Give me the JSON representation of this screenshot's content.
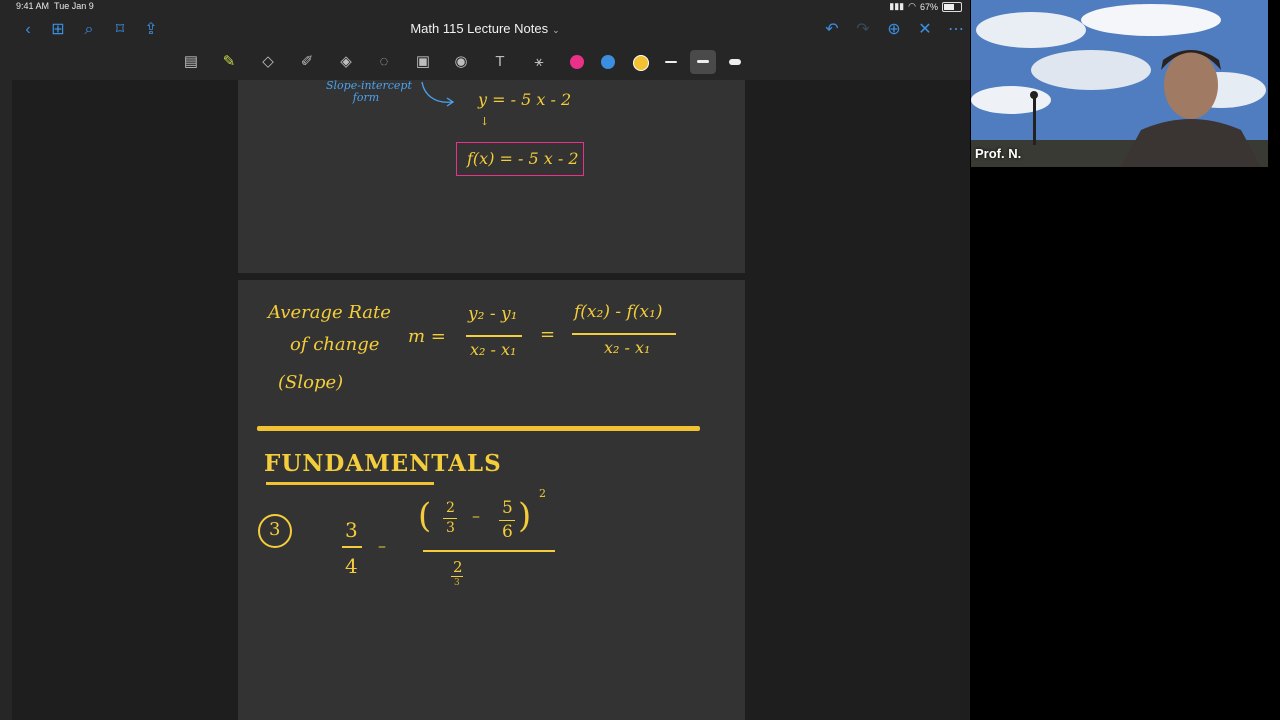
{
  "status_bar": {
    "time": "9:41 AM",
    "date": "Tue Jan 9",
    "battery": "67%"
  },
  "nav": {
    "title": "Math 115 Lecture Notes"
  },
  "toolbar": {
    "colors": [
      "#e9318a",
      "#3b8fe0",
      "#f1c232"
    ],
    "icons": [
      "bookmark-panel-icon",
      "pen-icon",
      "eraser-icon",
      "highlighter-icon",
      "shapes-icon",
      "lasso-icon",
      "image-icon",
      "camera-icon",
      "text-icon",
      "laser-pointer-icon"
    ]
  },
  "page1": {
    "annotation": "Slope-intercept\nform",
    "equation1": "y = - 5 x - 2",
    "equation_boxed": "f(x) = - 5 x - 2"
  },
  "page2": {
    "term_line1": "Average  Rate",
    "term_line2": "of  change",
    "term_line3": "(Slope)",
    "m_equals": "m =",
    "numerator1": "y₂ - y₁",
    "denominator1": "x₂ - x₁",
    "equals": "=",
    "numerator2": "f(x₂) - f(x₁)",
    "denominator2": "x₂ - x₁",
    "heading": "FUNDAMENTALS",
    "problem_number": "3",
    "frac1_num": "3",
    "frac1_den": "4",
    "minus": "–",
    "inner1_num": "2",
    "inner1_den": "3",
    "inner_minus": "–",
    "inner2_num": "5",
    "inner2_den": "6",
    "exponent": "2",
    "bottom_num": "2",
    "bottom_den": "3"
  },
  "video": {
    "participant": "Prof. N."
  }
}
